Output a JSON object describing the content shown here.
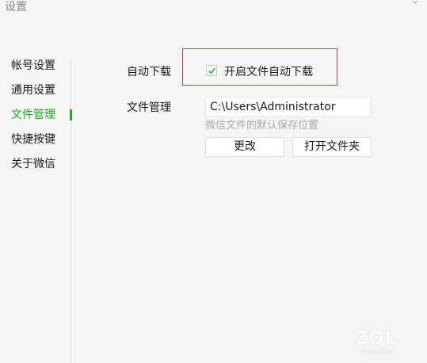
{
  "window": {
    "title": "设置",
    "close_icon": "close-icon"
  },
  "sidebar": {
    "items": [
      {
        "label": "帐号设置",
        "active": false
      },
      {
        "label": "通用设置",
        "active": false
      },
      {
        "label": "文件管理",
        "active": true
      },
      {
        "label": "快捷按键",
        "active": false
      },
      {
        "label": "关于微信",
        "active": false
      }
    ]
  },
  "main": {
    "auto_download": {
      "label": "自动下载",
      "checkbox_label": "开启文件自动下载",
      "checked": true
    },
    "file_manage": {
      "label": "文件管理",
      "path_value": "C:\\Users\\Administrator",
      "hint": "微信文件的默认保存位置",
      "change_button": "更改",
      "open_folder_button": "打开文件夹"
    }
  },
  "watermark": {
    "logo": "ZOL",
    "sub": "中关村在线"
  },
  "colors": {
    "accent": "#1aad19",
    "highlight_border": "#d93b3b",
    "background": "#f5f5f5"
  }
}
